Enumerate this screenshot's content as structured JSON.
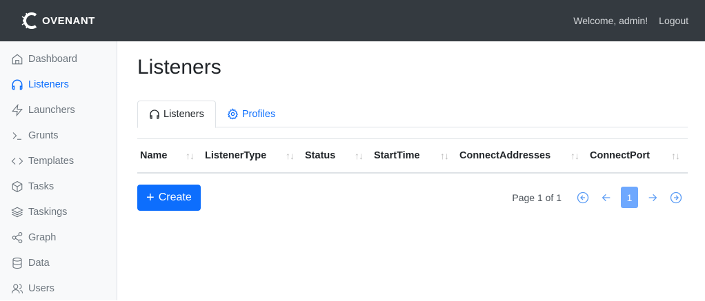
{
  "app": {
    "logo_text": "OVENANT"
  },
  "header": {
    "welcome": "Welcome, admin!",
    "logout": "Logout"
  },
  "sidebar": {
    "items": [
      {
        "label": "Dashboard",
        "icon": "home-icon"
      },
      {
        "label": "Listeners",
        "icon": "headphones-icon",
        "active": true
      },
      {
        "label": "Launchers",
        "icon": "lightning-icon"
      },
      {
        "label": "Grunts",
        "icon": "terminal-icon"
      },
      {
        "label": "Templates",
        "icon": "code-icon"
      },
      {
        "label": "Tasks",
        "icon": "box-icon"
      },
      {
        "label": "Taskings",
        "icon": "layers-icon"
      },
      {
        "label": "Graph",
        "icon": "share-icon"
      },
      {
        "label": "Data",
        "icon": "database-icon"
      },
      {
        "label": "Users",
        "icon": "users-icon"
      }
    ]
  },
  "main": {
    "title": "Listeners",
    "tabs": [
      {
        "label": "Listeners",
        "icon": "headphones-icon"
      },
      {
        "label": "Profiles",
        "icon": "gear-icon"
      }
    ],
    "table": {
      "columns": [
        "Name",
        "ListenerType",
        "Status",
        "StartTime",
        "ConnectAddresses",
        "ConnectPort"
      ],
      "rows": []
    },
    "create_label": "Create",
    "pagination": {
      "info": "Page 1 of 1",
      "current_page": "1"
    }
  },
  "colors": {
    "accent": "#0d6efd",
    "topbar": "#343a40",
    "sidebar": "#f8f9fa"
  }
}
